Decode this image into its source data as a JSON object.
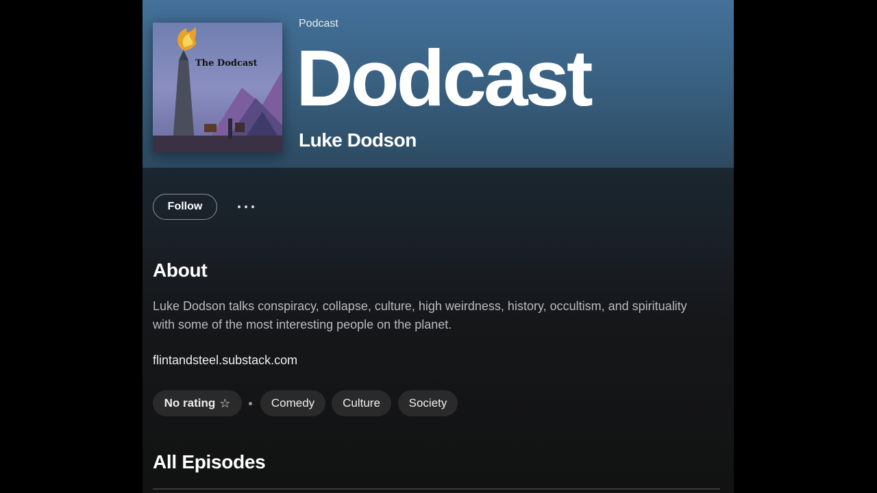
{
  "header": {
    "type_label": "Podcast",
    "title": "Dodcast",
    "publisher": "Luke Dodson",
    "cover_text": "The Dodcast"
  },
  "actions": {
    "follow_label": "Follow",
    "more_icon": "more-horizontal-icon"
  },
  "about": {
    "heading": "About",
    "description": "Luke Dodson talks conspiracy, collapse, culture, high weirdness, history, occultism, and spirituality with some of the most interesting people on the planet.",
    "website": "flintandsteel.substack.com"
  },
  "tags": {
    "rating_label": "No rating",
    "rating_icon": "star-outline-icon",
    "categories": [
      "Comedy",
      "Culture",
      "Society"
    ]
  },
  "episodes": {
    "heading": "All Episodes"
  },
  "colors": {
    "hero_top": "#44719a",
    "hero_bottom": "#2c4a61",
    "page_bg": "#121212",
    "pill_bg": "#2a2a2a"
  }
}
